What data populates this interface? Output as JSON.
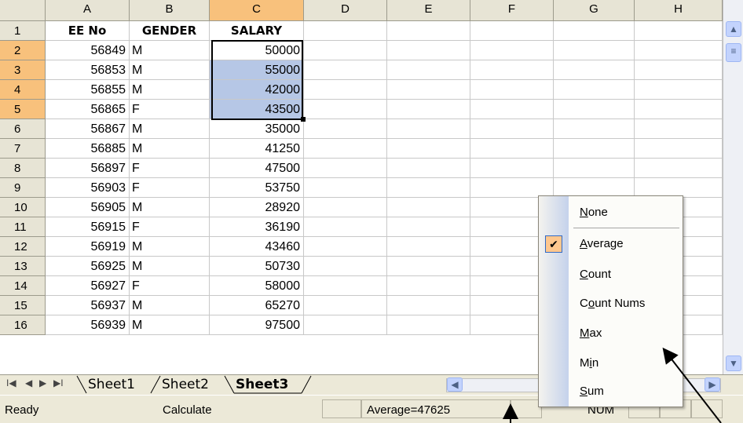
{
  "columns": [
    "A",
    "B",
    "C",
    "D",
    "E",
    "F",
    "G",
    "H"
  ],
  "rows": [
    {
      "num": "1",
      "a": "EE No",
      "b": "GENDER",
      "c": "SALARY"
    },
    {
      "num": "2",
      "a": "56849",
      "b": "M",
      "c": "50000"
    },
    {
      "num": "3",
      "a": "56853",
      "b": "M",
      "c": "55000"
    },
    {
      "num": "4",
      "a": "56855",
      "b": "M",
      "c": "42000"
    },
    {
      "num": "5",
      "a": "56865",
      "b": "F",
      "c": "43500"
    },
    {
      "num": "6",
      "a": "56867",
      "b": "M",
      "c": "35000"
    },
    {
      "num": "7",
      "a": "56885",
      "b": "M",
      "c": "41250"
    },
    {
      "num": "8",
      "a": "56897",
      "b": "F",
      "c": "47500"
    },
    {
      "num": "9",
      "a": "56903",
      "b": "F",
      "c": "53750"
    },
    {
      "num": "10",
      "a": "56905",
      "b": "M",
      "c": "28920"
    },
    {
      "num": "11",
      "a": "56915",
      "b": "F",
      "c": "36190"
    },
    {
      "num": "12",
      "a": "56919",
      "b": "M",
      "c": "43460"
    },
    {
      "num": "13",
      "a": "56925",
      "b": "M",
      "c": "50730"
    },
    {
      "num": "14",
      "a": "56927",
      "b": "F",
      "c": "58000"
    },
    {
      "num": "15",
      "a": "56937",
      "b": "M",
      "c": "65270"
    },
    {
      "num": "16",
      "a": "56939",
      "b": "M",
      "c": "97500"
    }
  ],
  "tabs": [
    "Sheet1",
    "Sheet2",
    "Sheet3"
  ],
  "active_tab": "Sheet3",
  "status": {
    "ready": "Ready",
    "calculate": "Calculate",
    "average": "Average=47625",
    "num": "NUM"
  },
  "menu": {
    "items": [
      {
        "key": "N",
        "rest": "one"
      },
      {
        "key": "A",
        "rest": "verage"
      },
      {
        "key": "C",
        "rest": "ount"
      },
      {
        "pre": "C",
        "key": "o",
        "rest": "unt Nums"
      },
      {
        "key": "M",
        "rest": "ax"
      },
      {
        "pre": "M",
        "key": "i",
        "rest": "n"
      },
      {
        "key": "S",
        "rest": "um"
      }
    ],
    "checked": "Average"
  },
  "colors": {
    "selected_header": "#f8c17c",
    "selection_fill": "#b6c7e6",
    "header_bg": "#e7e4d5"
  }
}
